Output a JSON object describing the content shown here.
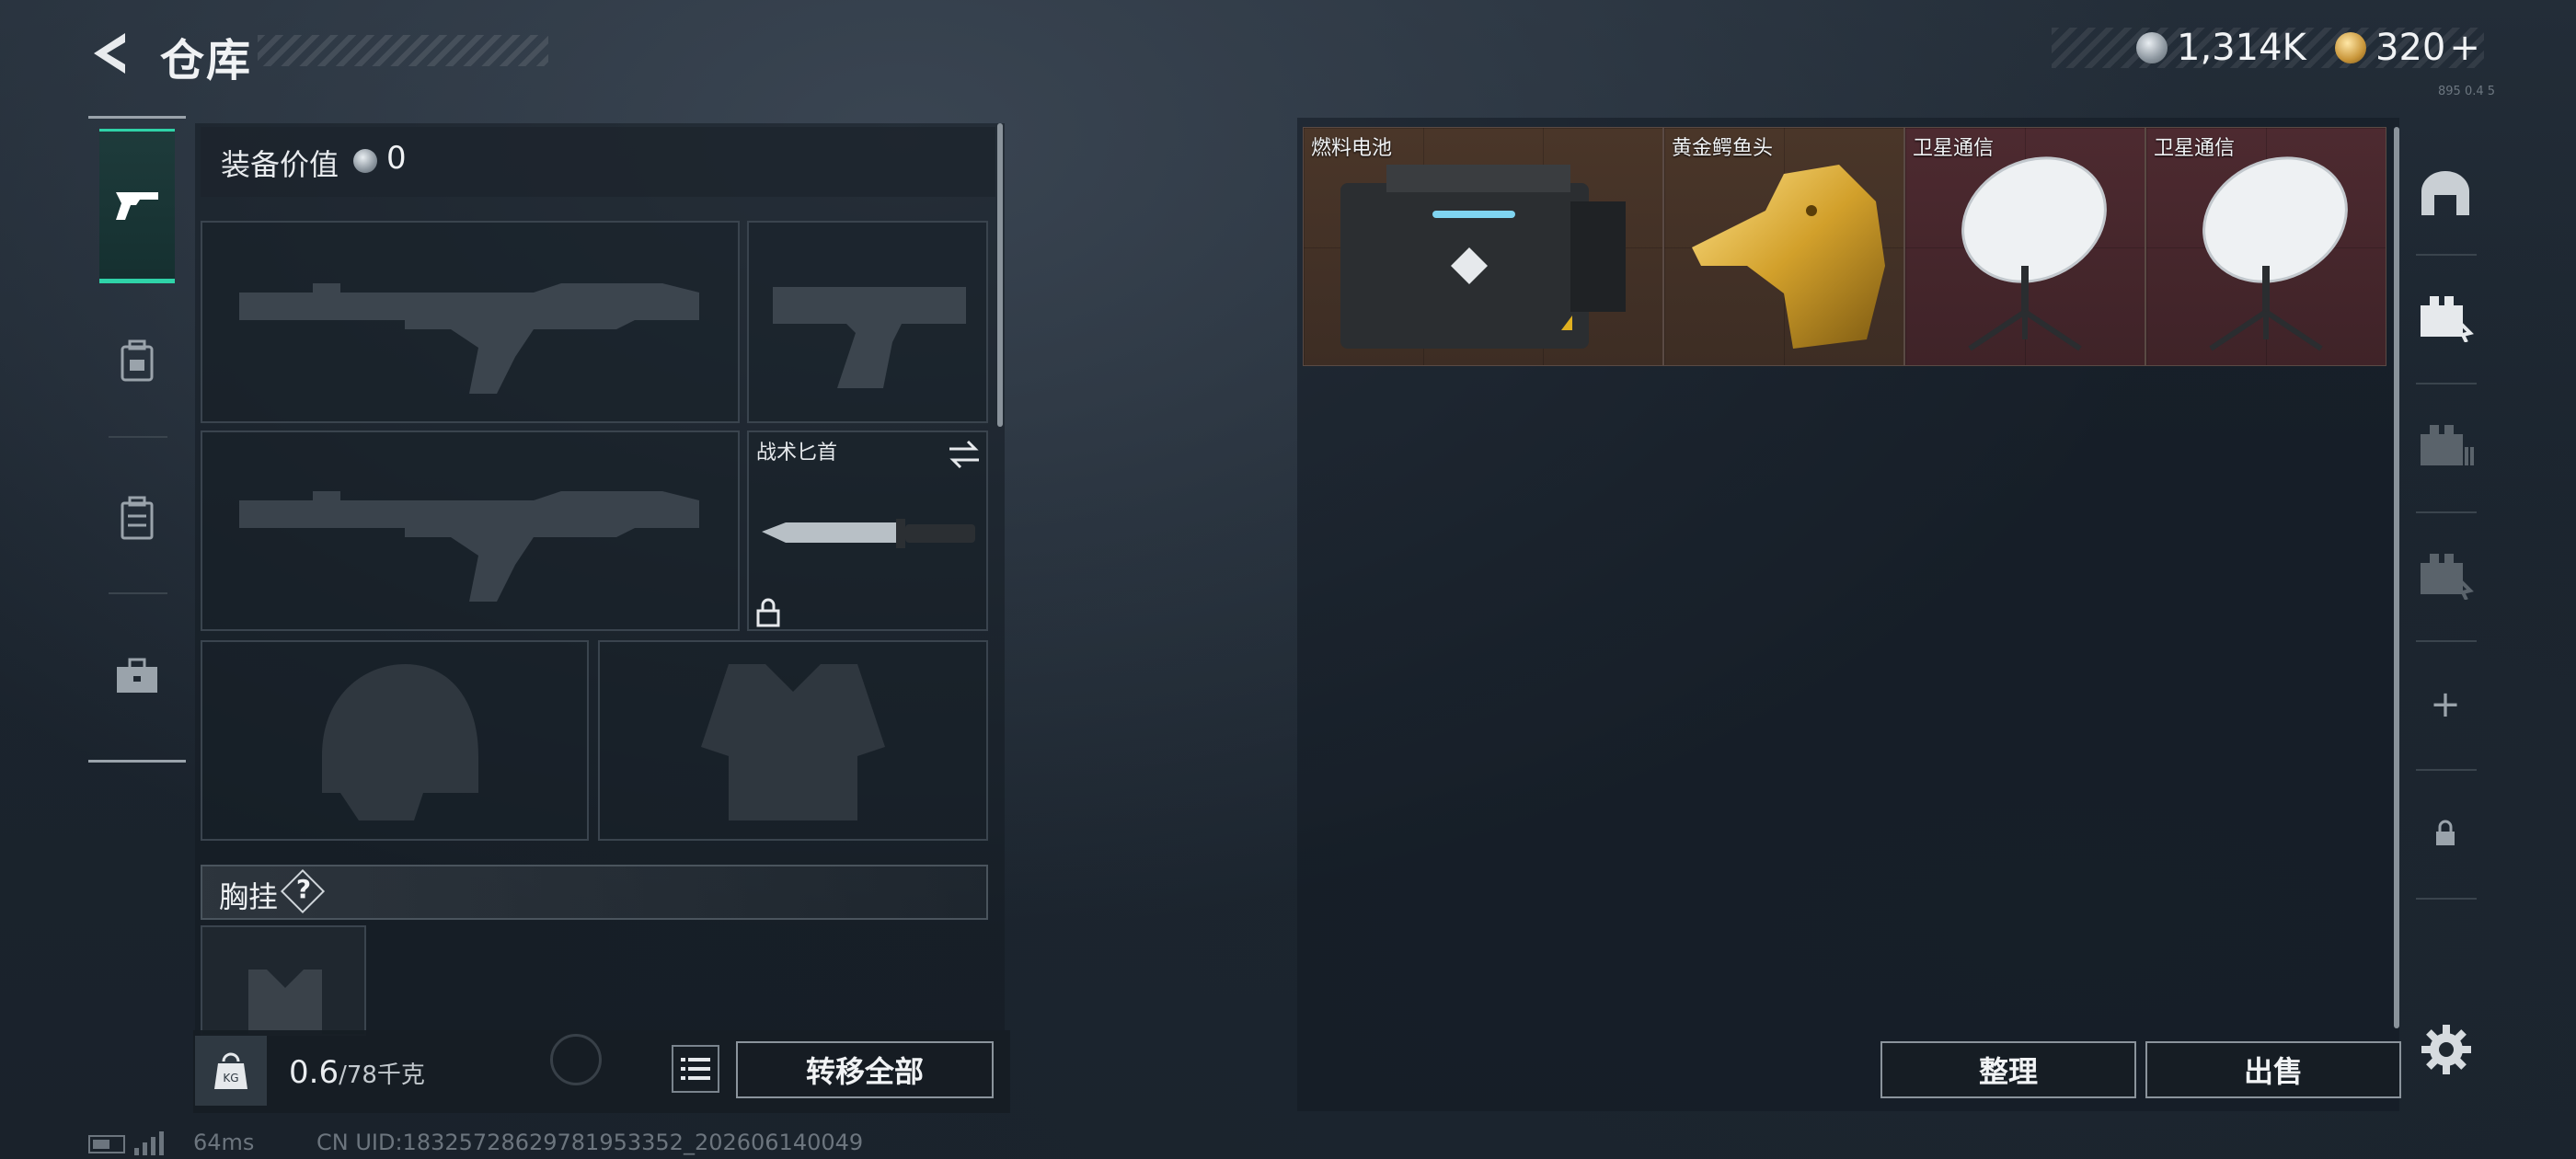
{
  "header": {
    "title": "仓库",
    "currency_silver": "1,314K",
    "currency_gold": "320",
    "gold_plus": "+",
    "version": "895 0.4 5"
  },
  "categories": [
    {
      "name": "weapons",
      "icon": "pistol-icon",
      "active": true
    },
    {
      "name": "armor",
      "icon": "armor-icon",
      "active": false
    },
    {
      "name": "backpack",
      "icon": "backpack-icon",
      "active": false
    },
    {
      "name": "toolbox",
      "icon": "toolbox-icon",
      "active": false
    }
  ],
  "equipment": {
    "value_label": "装备价值",
    "value": "0",
    "melee_name": "战术匕首",
    "vest_label": "胸挂",
    "vest_help": "?"
  },
  "footer": {
    "weight_current": "0.6",
    "weight_max": "/78千克",
    "move_all": "转移全部",
    "ping": "64ms",
    "uid": "CN UID:18325728629781953352_202606140049"
  },
  "storage": {
    "items": [
      {
        "name": "燃料电池",
        "rarity": "orange",
        "icon": "fuel-battery-icon"
      },
      {
        "name": "黄金鳄鱼头",
        "rarity": "orange",
        "icon": "golden-crocodile-head-icon"
      },
      {
        "name": "卫星通信",
        "rarity": "red",
        "icon": "satellite-dish-icon"
      },
      {
        "name": "卫星通信",
        "rarity": "red",
        "icon": "satellite-dish-icon"
      }
    ],
    "sort_label": "整理",
    "sell_label": "出售"
  },
  "side_tabs": [
    {
      "icon": "storage-arch-icon"
    },
    {
      "icon": "storage-tab-2-icon"
    },
    {
      "icon": "storage-tab-3-icon"
    },
    {
      "icon": "storage-tab-4-icon"
    },
    {
      "icon": "add-icon",
      "label": "+"
    },
    {
      "icon": "lock-icon"
    }
  ],
  "colors": {
    "accent": "#2fd3a8",
    "rarity_orange": "#4a3629",
    "rarity_red": "#4d2a30"
  }
}
